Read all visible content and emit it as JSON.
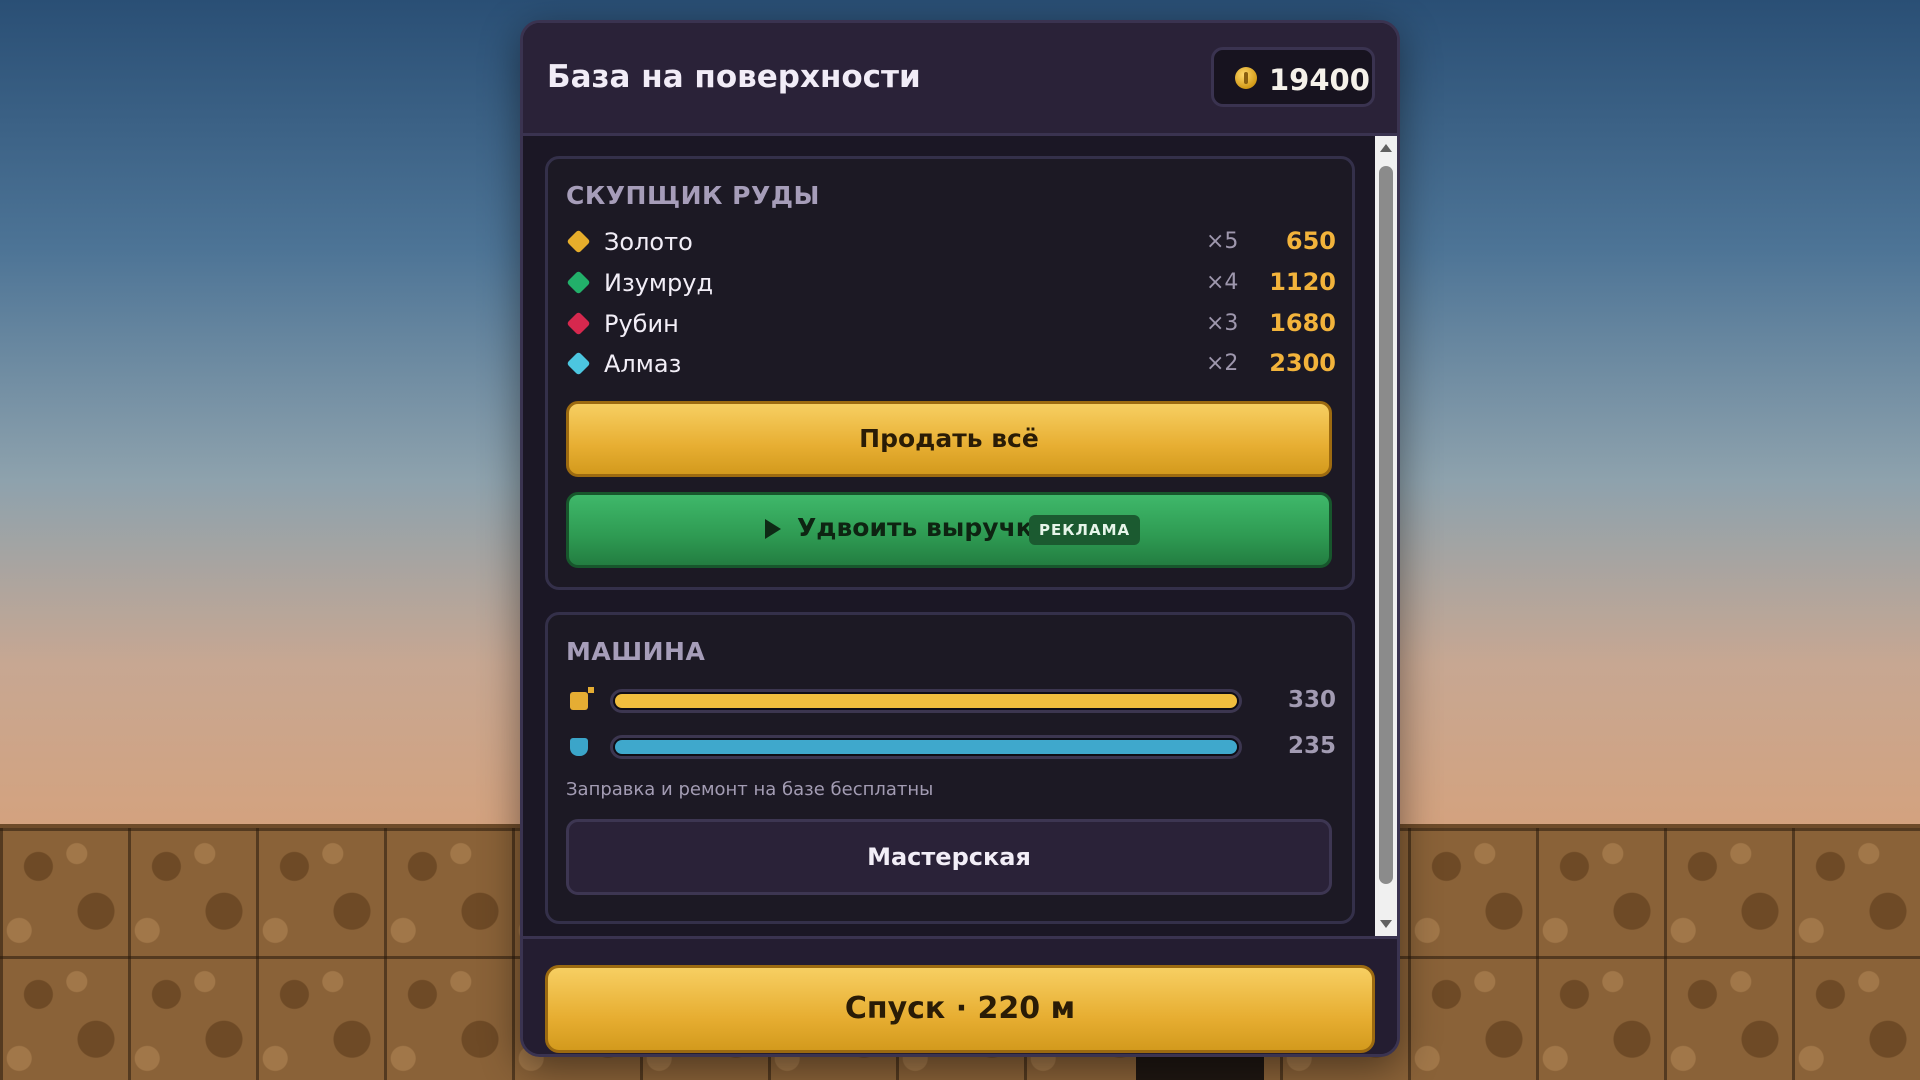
{
  "header": {
    "title": "База на поверхности",
    "coins": "19400"
  },
  "ore_buyer": {
    "title": "СКУПЩИК РУДЫ",
    "items": [
      {
        "name": "Золото",
        "qty": "×5",
        "price": "650",
        "color": "#e6ad2b"
      },
      {
        "name": "Изумруд",
        "qty": "×4",
        "price": "1120",
        "color": "#22b06a"
      },
      {
        "name": "Рубин",
        "qty": "×3",
        "price": "1680",
        "color": "#d6284e"
      },
      {
        "name": "Алмаз",
        "qty": "×2",
        "price": "2300",
        "color": "#4cc6e0"
      }
    ],
    "sell_label": "Продать всё",
    "double_label": "Удвоить выручку",
    "ad_badge": "РЕКЛАМА"
  },
  "car": {
    "title": "МАШИНА",
    "fuel": {
      "value": "330",
      "fill": 1.0,
      "color": "#f1be3e",
      "icon": "fuel-can-icon"
    },
    "armor": {
      "value": "235",
      "fill": 1.0,
      "color": "#3fa8cc",
      "icon": "shield-icon"
    },
    "note": "Заправка и ремонт на базе бесплатны",
    "workshop_label": "Мастерская"
  },
  "footer": {
    "descend_label": "Спуск · 220 м"
  }
}
